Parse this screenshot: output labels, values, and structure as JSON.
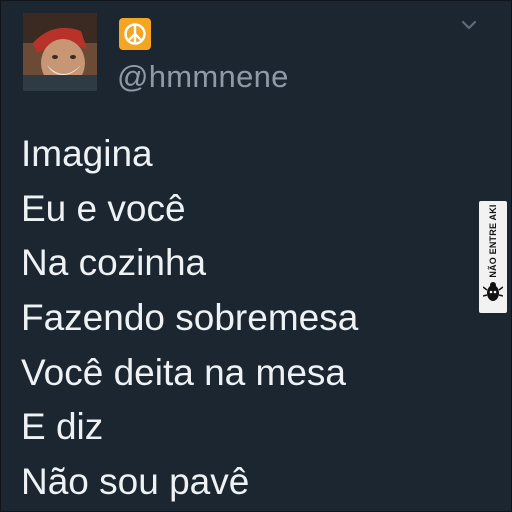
{
  "profile": {
    "handle": "@hmmnene",
    "emoji_icon": "peace-symbol-icon",
    "emoji_bg": "#f4a623"
  },
  "tweet": {
    "lines": [
      "Imagina",
      "Eu e você",
      "Na cozinha",
      "Fazendo sobremesa",
      "Você deita na mesa",
      "E diz",
      "Não sou pavê"
    ]
  },
  "watermark": {
    "text": "NÃO ENTRE AKI"
  },
  "colors": {
    "background": "#1b2631",
    "text": "#eef2f5",
    "handle": "#8f9aa6"
  }
}
